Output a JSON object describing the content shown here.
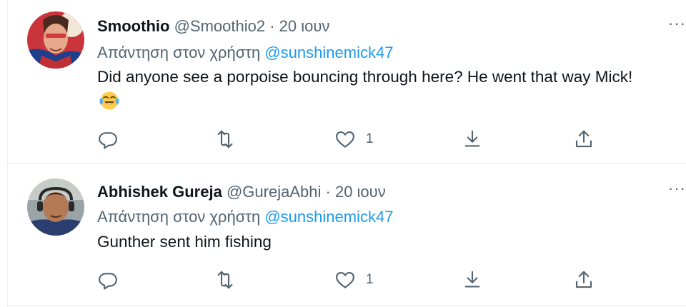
{
  "tweets": [
    {
      "name": "Smoothio",
      "handle": "@Smoothio2",
      "dot": "·",
      "date": "20 ιουν",
      "reply_prefix": "Απάντηση στον χρήστη",
      "reply_to": "@sunshinemick47",
      "text": "Did anyone see a porpoise bouncing through here? He went that way Mick!",
      "emoji": "face-with-tears-of-joy",
      "more": "···",
      "likes": "1"
    },
    {
      "name": "Abhishek Gureja",
      "handle": "@GurejaAbhi",
      "dot": "·",
      "date": "20 ιουν",
      "reply_prefix": "Απάντηση στον χρήστη",
      "reply_to": "@sunshinemick47",
      "text": "Gunther sent him fishing",
      "more": "···",
      "likes": "1"
    }
  ],
  "colors": {
    "text": "#0f1419",
    "secondary": "#536471",
    "link": "#1d9bf0",
    "divider": "#e7ebee"
  },
  "icons": [
    "reply-icon",
    "retweet-icon",
    "like-icon",
    "share-icon",
    "upload-icon",
    "more-icon"
  ]
}
